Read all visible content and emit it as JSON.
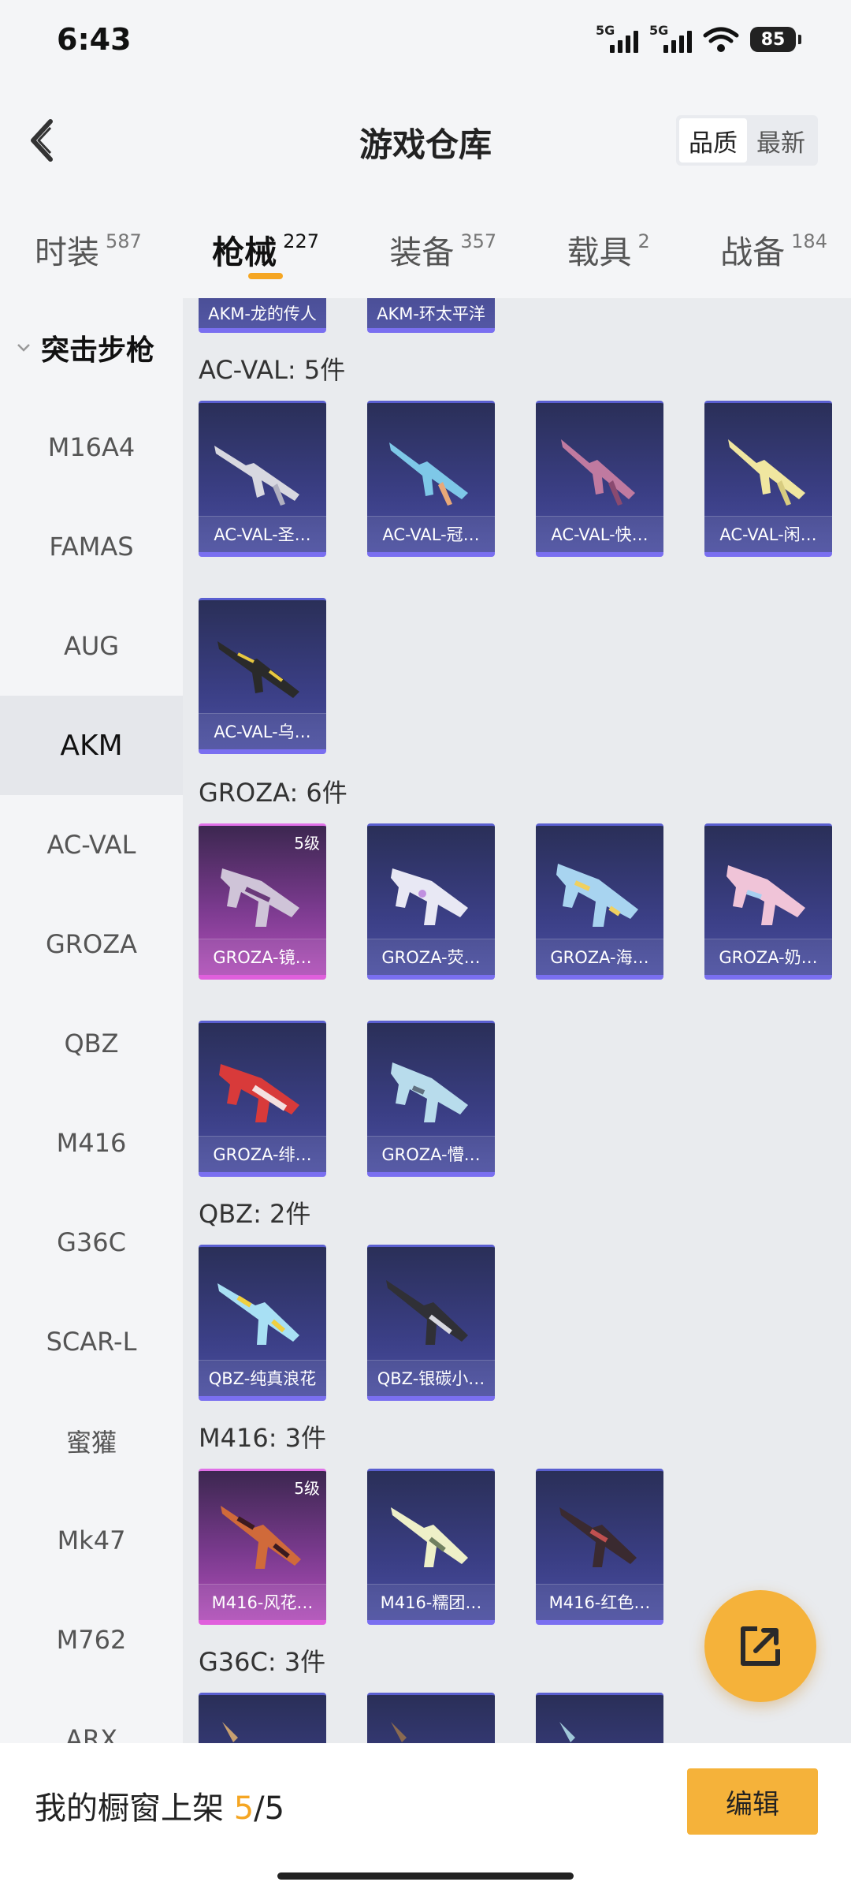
{
  "status_bar": {
    "time": "6:43",
    "network_1": "5G",
    "network_2": "5G",
    "battery": "85"
  },
  "header": {
    "title": "游戏仓库",
    "sort_options": [
      "品质",
      "最新"
    ],
    "sort_active": "品质"
  },
  "tabs": [
    {
      "label": "时装",
      "count": "587"
    },
    {
      "label": "枪械",
      "count": "227",
      "active": true
    },
    {
      "label": "装备",
      "count": "357"
    },
    {
      "label": "载具",
      "count": "2"
    },
    {
      "label": "战备",
      "count": "184"
    }
  ],
  "sidebar": {
    "group": "突击步枪",
    "items": [
      "M16A4",
      "FAMAS",
      "AUG",
      "AKM",
      "AC-VAL",
      "GROZA",
      "QBZ",
      "M416",
      "G36C",
      "SCAR-L",
      "蜜獾",
      "Mk47",
      "M762",
      "ARX"
    ],
    "active": "AKM"
  },
  "sections": {
    "akm_partial": [
      "AKM-龙的传人",
      "AKM-环太平洋"
    ],
    "acval": {
      "title": "AC-VAL: 5件",
      "items": [
        "AC-VAL-圣…",
        "AC-VAL-冠…",
        "AC-VAL-快…",
        "AC-VAL-闲…",
        "AC-VAL-乌…"
      ]
    },
    "groza": {
      "title": "GROZA: 6件",
      "items": [
        "GROZA-镜…",
        "GROZA-荧…",
        "GROZA-海…",
        "GROZA-奶…",
        "GROZA-绯…",
        "GROZA-懵…"
      ],
      "level_badge": "5级"
    },
    "qbz": {
      "title": "QBZ: 2件",
      "items": [
        "QBZ-纯真浪花",
        "QBZ-银碳小…"
      ]
    },
    "m416": {
      "title": "M416: 3件",
      "items": [
        "M416-风花…",
        "M416-糯团…",
        "M416-红色…"
      ],
      "level_badge": "5级"
    },
    "g36c": {
      "title": "G36C: 3件"
    }
  },
  "bottom_bar": {
    "shelf_label": "我的橱窗上架",
    "shelf_current": "5",
    "shelf_sep": "/",
    "shelf_total": "5",
    "edit_label": "编辑"
  },
  "colors": {
    "accent": "#f5a623",
    "card_blue": "#3b3f86",
    "card_purple": "#b04fb8"
  },
  "icons": [
    "back-arrow-icon",
    "chevron-down-icon",
    "share-icon"
  ]
}
